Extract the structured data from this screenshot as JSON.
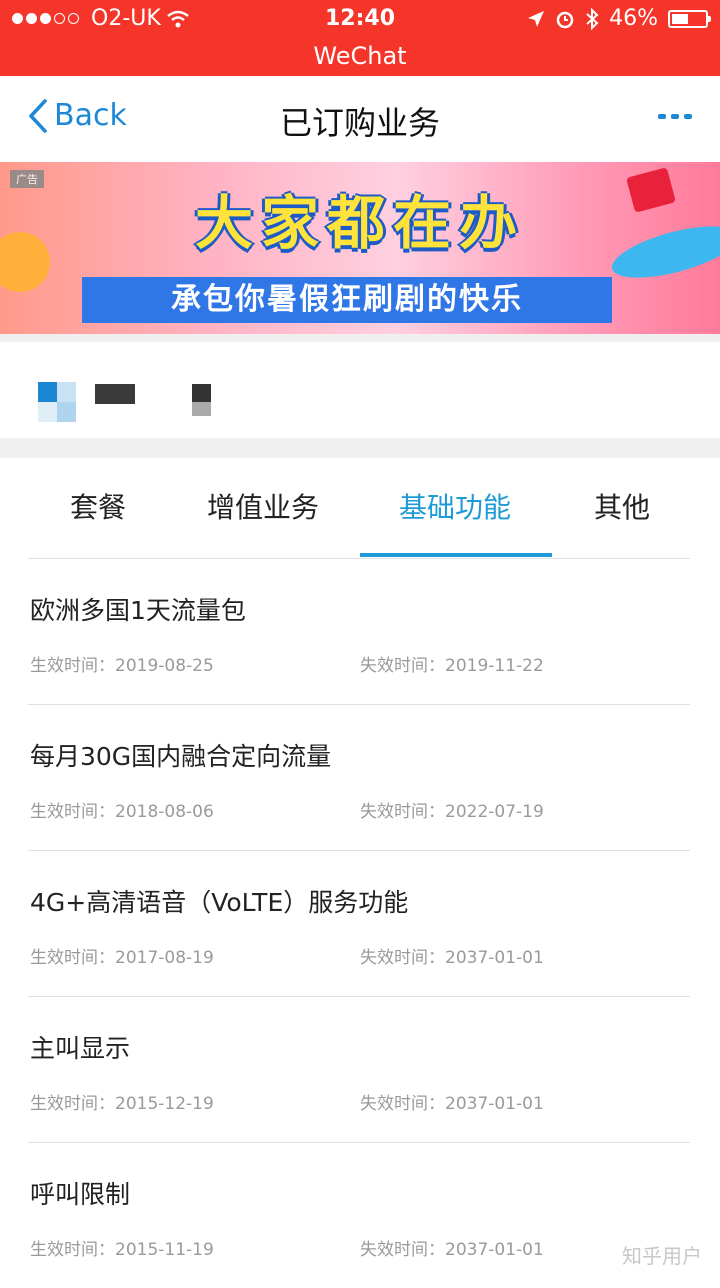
{
  "status_bar": {
    "carrier": "O2-UK",
    "time": "12:40",
    "battery": "46%",
    "app": "WeChat"
  },
  "nav": {
    "back_label": "Back",
    "title": "已订购业务"
  },
  "banner": {
    "ad_tag": "广告",
    "headline": "大家都在办",
    "subline": "承包你暑假狂刷剧的快乐"
  },
  "tabs": [
    {
      "label": "套餐",
      "active": false
    },
    {
      "label": "增值业务",
      "active": false
    },
    {
      "label": "基础功能",
      "active": true
    },
    {
      "label": "其他",
      "active": false
    }
  ],
  "items": [
    {
      "name": "欧洲多国1天流量包",
      "start": "生效时间：2019-08-25",
      "end": "失效时间：2019-11-22"
    },
    {
      "name": "每月30G国内融合定向流量",
      "start": "生效时间：2018-08-06",
      "end": "失效时间：2022-07-19"
    },
    {
      "name": "4G+高清语音（VoLTE）服务功能",
      "start": "生效时间：2017-08-19",
      "end": "失效时间：2037-01-01"
    },
    {
      "name": "主叫显示",
      "start": "生效时间：2015-12-19",
      "end": "失效时间：2037-01-01"
    },
    {
      "name": "呼叫限制",
      "start": "生效时间：2015-11-19",
      "end": "失效时间：2037-01-01"
    }
  ],
  "watermark": "知乎用户",
  "colors": {
    "status_bar": "#f5342a",
    "accent": "#1e9bd7"
  },
  "icons": [
    "cellular-signal-icon",
    "wifi-icon",
    "location-arrow-icon",
    "alarm-icon",
    "bluetooth-icon",
    "battery-icon",
    "chevron-left-icon",
    "more-dots-icon"
  ]
}
